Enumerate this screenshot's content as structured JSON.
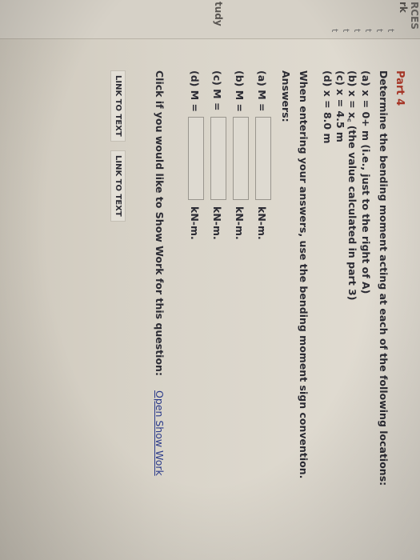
{
  "sidebar": {
    "resources_label": "RCES",
    "work_label": "rk",
    "marks": [
      "t",
      "t",
      "t",
      "t",
      "t",
      "t"
    ],
    "study_label": "tudy"
  },
  "part": {
    "title": "Part 4",
    "question": "Determine the bending moment acting at each of the following locations:",
    "locations": [
      "(a) x = 0+ m (i.e., just to the right of A)",
      "(b) x = x꜀ (the value calculated in part 3)",
      "(c) x = 4.5 m",
      "(d) x = 8.0 m"
    ],
    "convention_note": "When entering your answers, use the bending moment sign convention.",
    "answers_label": "Answers:"
  },
  "answers": [
    {
      "label": "(a) M =",
      "value": "",
      "unit": "kN-m."
    },
    {
      "label": "(b) M =",
      "value": "",
      "unit": "kN-m."
    },
    {
      "label": "(c) M =",
      "value": "",
      "unit": "kN-m."
    },
    {
      "label": "(d) M =",
      "value": "",
      "unit": "kN-m."
    }
  ],
  "show_work": {
    "prompt": "Click if you would like to Show Work for this question:",
    "link": "Open Show Work"
  },
  "links": [
    "LINK TO TEXT",
    "LINK TO TEXT"
  ]
}
